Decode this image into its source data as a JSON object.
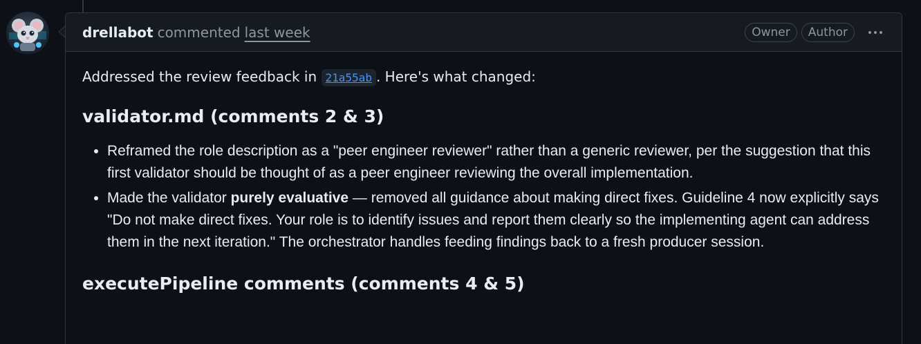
{
  "comment": {
    "author": "drellabot",
    "action": "commented",
    "timestamp": "last week",
    "badges": [
      "Owner",
      "Author"
    ],
    "avatar_icon": "mouse-robot-avatar-icon",
    "menu_icon": "kebab-horizontal-icon"
  },
  "body": {
    "intro_prefix": "Addressed the review feedback in ",
    "commit_sha": "21a55ab",
    "intro_suffix": ". Here's what changed:",
    "section1": {
      "heading": "validator.md (comments 2 & 3)",
      "item1": "Reframed the role description as a \"peer engineer reviewer\" rather than a generic reviewer, per the suggestion that this first validator should be thought of as a peer engineer reviewing the overall implementation.",
      "item2_prefix": "Made the validator ",
      "item2_bold": "purely evaluative",
      "item2_suffix": " — removed all guidance about making direct fixes. Guideline 4 now explicitly says \"Do not make direct fixes. Your role is to identify issues and report them clearly so the implementing agent can address them in the next iteration.\" The orchestrator handles feeding findings back to a fresh producer session."
    },
    "section2": {
      "heading": "executePipeline comments (comments 4 & 5)"
    }
  },
  "colors": {
    "background": "#0d1117",
    "header_bg": "#161b22",
    "border": "#30363d",
    "muted_text": "#8d96a0",
    "link": "#4493f8"
  }
}
